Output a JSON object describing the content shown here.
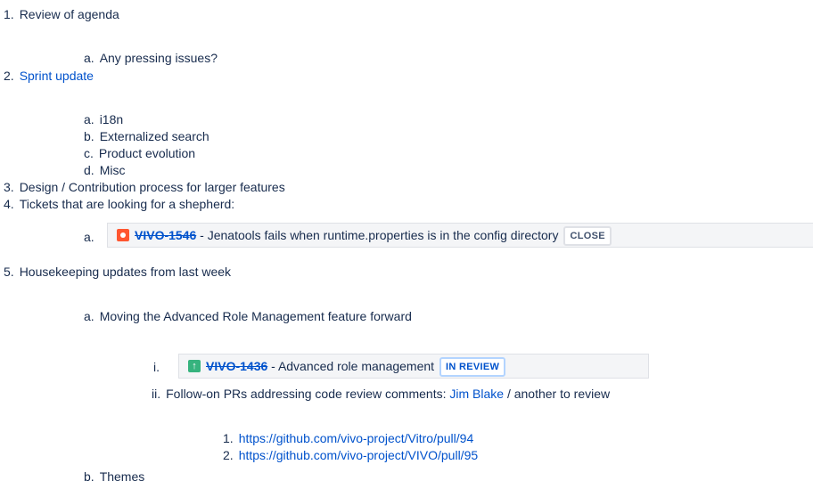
{
  "items": [
    {
      "marker": "1.",
      "text": "Review of agenda"
    },
    {
      "marker": "a.",
      "text": "Any pressing issues?"
    },
    {
      "marker": "2.",
      "link": "Sprint update"
    },
    {
      "marker": "a.",
      "text": "i18n"
    },
    {
      "marker": "b.",
      "text": "Externalized search"
    },
    {
      "marker": "c.",
      "text": "Product evolution"
    },
    {
      "marker": "d.",
      "text": "Misc"
    },
    {
      "marker": "3.",
      "text": "Design / Contribution process for larger features"
    },
    {
      "marker": "4.",
      "text": "Tickets that are looking for a shepherd:"
    },
    {
      "marker": "a."
    },
    {
      "marker": "5.",
      "text": "Housekeeping updates from last week"
    },
    {
      "marker": "a.",
      "text": "Moving the Advanced Role Management feature forward"
    },
    {
      "marker": "i."
    },
    {
      "marker": "ii.",
      "text": "Follow-on PRs addressing code review comments: ",
      "mention": "Jim Blake",
      "suffix": " / another to review"
    },
    {
      "marker": "1.",
      "link": "https://github.com/vivo-project/Vitro/pull/94"
    },
    {
      "marker": "2.",
      "link": "https://github.com/vivo-project/VIVO/pull/95"
    },
    {
      "marker": "b.",
      "text": "Themes"
    }
  ],
  "jira": [
    {
      "key": "VIVO-1546",
      "separator": " - ",
      "summary": "Jenatools fails when runtime.properties is in the config directory",
      "status": "CLOSE",
      "icon": "bug-icon",
      "icon_color": "#ff5630"
    },
    {
      "key": "VIVO-1436",
      "separator": " - ",
      "summary": "Advanced role management",
      "status": "IN REVIEW",
      "icon": "arrow-up-icon",
      "icon_color": "#36b37e"
    }
  ]
}
